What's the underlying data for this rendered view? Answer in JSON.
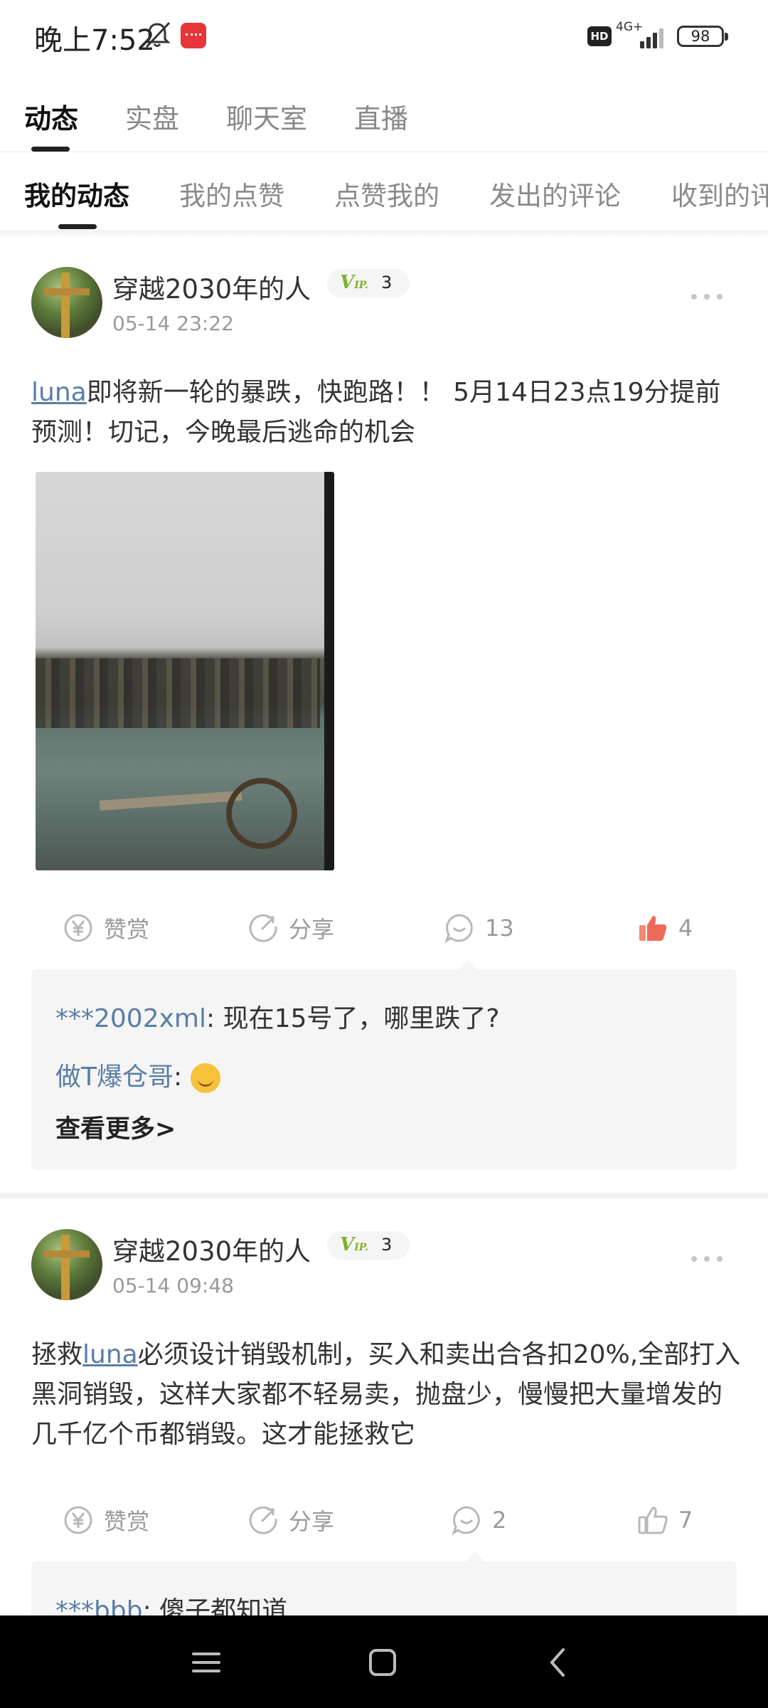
{
  "status_bar": {
    "time": "晚上7:52",
    "hd": "HD",
    "network": "4G+",
    "battery": "98"
  },
  "top_tabs": [
    "动态",
    "实盘",
    "聊天室",
    "直播"
  ],
  "sub_tabs": [
    "我的动态",
    "我的点赞",
    "点赞我的",
    "发出的评论",
    "收到的评"
  ],
  "colors": {
    "mention": "#5a7ea6",
    "vip_green": "#7cb32a",
    "muted": "#9a9a9a",
    "like_active": "#f06a5a"
  },
  "posts": [
    {
      "username": "穿越2030年的人",
      "vip_level": "3",
      "time": "05-14 23:22",
      "mention": "luna",
      "text_after": "即将新一轮的暴跌，快跑路！！ 5月14日23点19分提前预测！切记，今晚最后逃命的机会",
      "actions": {
        "reward": "赞赏",
        "share": "分享",
        "comments": "13",
        "likes": "4"
      },
      "comments": [
        {
          "user": "***2002xml",
          "sep": ": ",
          "text": "现在15号了，哪里跌了?"
        },
        {
          "user": "做T爆仓哥",
          "sep": ": ",
          "text": ""
        }
      ],
      "see_more": "查看更多>"
    },
    {
      "username": "穿越2030年的人",
      "vip_level": "3",
      "time": "05-14 09:48",
      "text_before": "拯救",
      "mention": "luna",
      "text_after": "必须设计销毁机制，买入和卖出合各扣20%,全部打入黑洞销毁，这样大家都不轻易卖，抛盘少，慢慢把大量增发的几千亿个币都销毁。这才能拯救它",
      "actions": {
        "reward": "赞赏",
        "share": "分享",
        "comments": "2",
        "likes": "7"
      },
      "comments": [
        {
          "user": "***bbb",
          "sep": ": ",
          "text": "傻子都知道"
        }
      ]
    }
  ],
  "icons": {
    "bell": "bell-off-icon",
    "reward": "yen-circle-icon",
    "share": "share-icon",
    "comment": "comment-icon",
    "like": "thumbs-up-icon",
    "more": "more-dots-icon",
    "nav": [
      "menu-icon",
      "home-square-icon",
      "back-chevron-icon"
    ]
  }
}
